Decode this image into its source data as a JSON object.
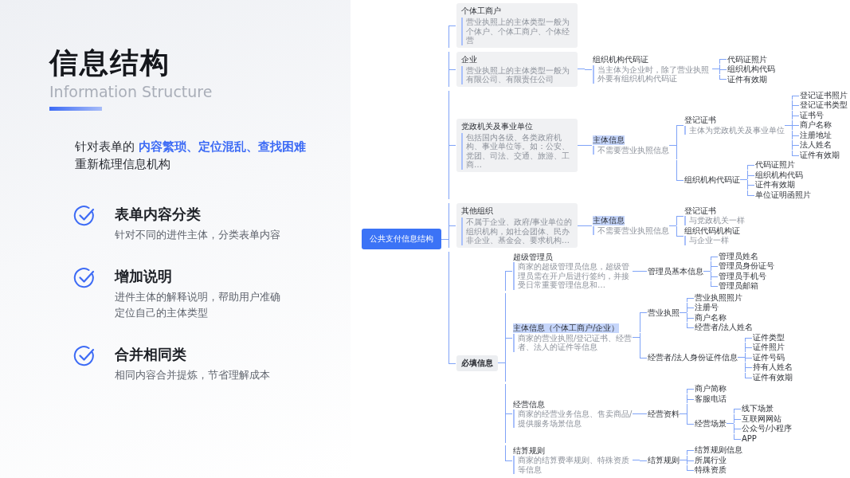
{
  "heading": {
    "title": "信息结构",
    "subtitle": "Information Structure"
  },
  "intro": [
    "针对表单的 **内容繁琐、定位混乱、查找困难**",
    "重新梳理信息机构"
  ],
  "features": [
    {
      "title": "表单内容分类",
      "desc_lines": [
        "针对不同的进件主体，分类表单内容"
      ]
    },
    {
      "title": "增加说明",
      "desc_lines": [
        "进件主体的解释说明，帮助用户准确",
        "定位自己的主体类型"
      ]
    },
    {
      "title": "合并相同类",
      "desc_lines": [
        "相同内容合并提炼，节省理解成本"
      ]
    }
  ],
  "mind_map": {
    "title": "公共支付信息结构",
    "kind": "root",
    "children": [
      {
        "title": "个体工商户",
        "kind": "card",
        "desc": "营业执照上的主体类型一般为个体户、个体工商户、个体经营"
      },
      {
        "title": "企业",
        "kind": "card",
        "desc": "营业执照上的主体类型一般为有限公司、有限责任公司",
        "children": [
          {
            "title": "组织机构代码证",
            "kind": "plain",
            "desc": "当主体为企业时，除了营业执照外要有组织机构代码证",
            "children": [
              {
                "title": "代码证照片",
                "kind": "plain"
              },
              {
                "title": "组织机构代码",
                "kind": "plain"
              },
              {
                "title": "证件有效期",
                "kind": "plain"
              }
            ]
          }
        ]
      },
      {
        "title": "党政机关及事业单位",
        "kind": "card",
        "desc": "包括国内各级、各类政府机构、事业单位等。如：公安、党团、司法、交通、旅游、工商…",
        "children": [
          {
            "title": "主体信息",
            "kind": "highlight",
            "desc": "不需要营业执照信息",
            "children": [
              {
                "title": "登记证书",
                "kind": "plain",
                "desc": "主体为党政机关及事业单位",
                "children": [
                  {
                    "title": "登记证书照片",
                    "kind": "plain"
                  },
                  {
                    "title": "登记证书类型",
                    "kind": "plain"
                  },
                  {
                    "title": "证书号",
                    "kind": "plain"
                  },
                  {
                    "title": "商户名称",
                    "kind": "plain"
                  },
                  {
                    "title": "注册地址",
                    "kind": "plain"
                  },
                  {
                    "title": "法人姓名",
                    "kind": "plain"
                  },
                  {
                    "title": "证件有效期",
                    "kind": "plain"
                  }
                ]
              },
              {
                "title": "组织机构代码证",
                "kind": "plain",
                "children": [
                  {
                    "title": "代码证照片",
                    "kind": "plain"
                  },
                  {
                    "title": "组织机构代码",
                    "kind": "plain"
                  },
                  {
                    "title": "证件有效期",
                    "kind": "plain"
                  },
                  {
                    "title": "单位证明函照片",
                    "kind": "plain"
                  }
                ]
              }
            ]
          }
        ]
      },
      {
        "title": "其他组织",
        "kind": "card",
        "desc": "不属于企业、政府/事业单位的组织机构，如社会团体、民办非企业、基金会、要求机构…",
        "children": [
          {
            "title": "主体信息",
            "kind": "highlight",
            "desc": "不需要营业执照信息",
            "children": [
              {
                "title": "登记证书",
                "kind": "plain",
                "desc": "与党政机关一样"
              },
              {
                "title": "组织代码机构证",
                "kind": "plain",
                "desc": "与企业一样"
              }
            ]
          }
        ]
      },
      {
        "title": "必填信息",
        "kind": "tag",
        "children": [
          {
            "title": "超级管理员",
            "kind": "plain",
            "desc": "商家的超级管理员信息，超级管理员需在开户后进行签约，并接受日常重要管理信息和…",
            "children": [
              {
                "title": "管理员基本信息",
                "kind": "plain",
                "children": [
                  {
                    "title": "管理员姓名",
                    "kind": "plain"
                  },
                  {
                    "title": "管理员身份证号",
                    "kind": "plain"
                  },
                  {
                    "title": "管理员手机号",
                    "kind": "plain"
                  },
                  {
                    "title": "管理员邮箱",
                    "kind": "plain"
                  }
                ]
              }
            ]
          },
          {
            "title": "主体信息（个体工商户/企业）",
            "kind": "highlight",
            "desc": "商家的营业执照/登记证书、经营者、法人的证件等信息",
            "children": [
              {
                "title": "营业执照",
                "kind": "plain",
                "children": [
                  {
                    "title": "营业执照照片",
                    "kind": "plain"
                  },
                  {
                    "title": "注册号",
                    "kind": "plain"
                  },
                  {
                    "title": "商户名称",
                    "kind": "plain"
                  },
                  {
                    "title": "经营者/法人姓名",
                    "kind": "plain"
                  }
                ]
              },
              {
                "title": "经营者/法人身份证件信息",
                "kind": "plain",
                "children": [
                  {
                    "title": "证件类型",
                    "kind": "plain"
                  },
                  {
                    "title": "证件照片",
                    "kind": "plain"
                  },
                  {
                    "title": "证件号码",
                    "kind": "plain"
                  },
                  {
                    "title": "持有人姓名",
                    "kind": "plain"
                  },
                  {
                    "title": "证件有效期",
                    "kind": "plain"
                  }
                ]
              }
            ]
          },
          {
            "title": "经营信息",
            "kind": "plain",
            "desc": "商家的经营业务信息、售卖商品/提供服务场景信息",
            "children": [
              {
                "title": "经营资料",
                "kind": "plain",
                "children": [
                  {
                    "title": "商户简称",
                    "kind": "plain"
                  },
                  {
                    "title": "客服电话",
                    "kind": "plain"
                  },
                  {
                    "title": "经营场景",
                    "kind": "plain",
                    "children": [
                      {
                        "title": "线下场景",
                        "kind": "plain"
                      },
                      {
                        "title": "互联网网站",
                        "kind": "plain"
                      },
                      {
                        "title": "公众号/小程序",
                        "kind": "plain"
                      },
                      {
                        "title": "APP",
                        "kind": "plain"
                      }
                    ]
                  }
                ]
              }
            ]
          },
          {
            "title": "结算规则",
            "kind": "plain",
            "desc": "商家的结算费率规则、特殊资质等信息",
            "children": [
              {
                "title": "结算规则",
                "kind": "plain",
                "children": [
                  {
                    "title": "结算规则信息",
                    "kind": "plain"
                  },
                  {
                    "title": "所属行业",
                    "kind": "plain"
                  },
                  {
                    "title": "特殊资质",
                    "kind": "plain"
                  }
                ]
              }
            ]
          }
        ]
      }
    ]
  }
}
